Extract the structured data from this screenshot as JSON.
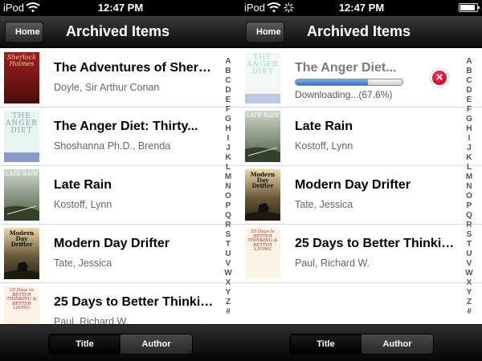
{
  "status": {
    "carrier": "iPod",
    "time": "12:47 PM"
  },
  "nav": {
    "back_label": "Home",
    "title": "Archived Items"
  },
  "index_letters": [
    "A",
    "B",
    "C",
    "D",
    "E",
    "F",
    "G",
    "H",
    "I",
    "J",
    "K",
    "L",
    "M",
    "N",
    "O",
    "P",
    "Q",
    "R",
    "S",
    "T",
    "U",
    "V",
    "W",
    "X",
    "Y",
    "Z",
    "#"
  ],
  "tabs": {
    "title_label": "Title",
    "author_label": "Author",
    "selected": "Title"
  },
  "left": {
    "items": [
      {
        "title": "The Adventures of Sherlock Holmes",
        "author": "Doyle, Sir Arthur Conan",
        "cover_text": "Sherlock Holmes"
      },
      {
        "title": "The Anger Diet: Thirty...",
        "author": "Shoshanna Ph.D., Brenda",
        "cover_text": "THE ANGER DIET"
      },
      {
        "title": "Late Rain",
        "author": "Kostoff, Lynn",
        "cover_text": "LATE RAIN"
      },
      {
        "title": "Modern Day Drifter",
        "author": "Tate, Jessica",
        "cover_text": "Modern Day Drifter"
      },
      {
        "title": "25 Days to Better Thinking...",
        "author": "Paul, Richard W.",
        "cover_text": "25 Days to BETTER THINKING & BETTER LIVING"
      }
    ]
  },
  "right": {
    "downloading": {
      "title": "The Anger Diet...",
      "cover_text": "THE ANGER DIET",
      "status_text": "Downloading...(67.6%)",
      "progress": 0.676
    },
    "items": [
      {
        "title": "Late Rain",
        "author": "Kostoff, Lynn",
        "cover_text": "LATE RAIN"
      },
      {
        "title": "Modern Day Drifter",
        "author": "Tate, Jessica",
        "cover_text": "Modern Day Drifter"
      },
      {
        "title": "25 Days to Better Thinking...",
        "author": "Paul, Richard W.",
        "cover_text": "25 Days to BETTER THINKING & BETTER LIVING"
      }
    ]
  }
}
